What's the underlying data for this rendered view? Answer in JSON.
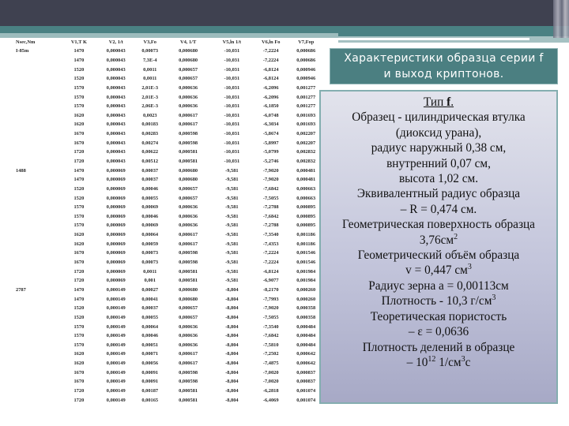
{
  "title_box": {
    "line1": "Характеристики образца серии f",
    "line2": "и выход криптонов."
  },
  "info_box": {
    "heading_prefix": "Тип ",
    "heading_bold": "f",
    "heading_suffix": ".",
    "lines": [
      "Образец - цилиндрическая втулка",
      "(диоксид урана),",
      "радиус наружный 0,38 см,",
      "внутренний 0,07 см,",
      "высота 1,02 см.",
      "Эквивалентный радиус образца",
      "– R = 0,474 см.",
      "Геометрическая поверхность образца"
    ],
    "surface_value": "3,76см",
    "surface_sup": "2",
    "volume_label": "Геометрический объём образца",
    "volume_value": "v = 0,447 см",
    "volume_sup": "3",
    "grain_radius": "Радиус зерна а = 0,00113см",
    "density_value": "Плотность - 10,3 г/см",
    "density_sup": "3",
    "porosity_label": "Теоретическая пористость",
    "porosity_value": "– ε = 0,0636",
    "fission_label": "Плотность делений в образце",
    "fission_prefix": "– 10",
    "fission_exp": "12",
    "fission_unit_a": " 1/см",
    "fission_unit_sup": "3",
    "fission_unit_b": "с"
  },
  "table": {
    "headers": [
      "Nsec,Nm",
      "V1,T K",
      "V2, 1/t",
      "V3,Fo",
      "V4, 1/T",
      "V5,ln 1/t",
      "V6,ln Fo",
      "V7,Fop"
    ],
    "rows": [
      [
        "I-85m",
        "1470",
        "0,000043",
        "0,00073",
        "0,000680",
        "-10,031",
        "-7,2224",
        "0,000686"
      ],
      [
        "",
        "1470",
        "0,000043",
        "7,3E-4",
        "0,000680",
        "-10,031",
        "-7,2224",
        "0,000686"
      ],
      [
        "",
        "1520",
        "0,000043",
        "0,0011",
        "0,000657",
        "-10,031",
        "-6,8124",
        "0,000946"
      ],
      [
        "",
        "1520",
        "0,000043",
        "0,0011",
        "0,000657",
        "-10,031",
        "-6,8124",
        "0,000946"
      ],
      [
        "",
        "1570",
        "0,000043",
        "2,01E-3",
        "0,000636",
        "-10,031",
        "-6,2096",
        "0,001277"
      ],
      [
        "",
        "1570",
        "0,000043",
        "2,01E-3",
        "0,000636",
        "-10,031",
        "-6,2096",
        "0,001277"
      ],
      [
        "",
        "1570",
        "0,000043",
        "2,06E-3",
        "0,000636",
        "-10,031",
        "-6,1850",
        "0,001277"
      ],
      [
        "",
        "1620",
        "0,000043",
        "0,0023",
        "0,000617",
        "-10,031",
        "-6,0748",
        "0,001693"
      ],
      [
        "",
        "1620",
        "0,000043",
        "0,00183",
        "0,000617",
        "-10,031",
        "-6,3034",
        "0,001693"
      ],
      [
        "",
        "1670",
        "0,000043",
        "0,00283",
        "0,000598",
        "-10,031",
        "-5,8674",
        "0,002207"
      ],
      [
        "",
        "1670",
        "0,000043",
        "0,00274",
        "0,000598",
        "-10,031",
        "-5,8997",
        "0,002207"
      ],
      [
        "",
        "1720",
        "0,000043",
        "0,00622",
        "0,000581",
        "-10,031",
        "-5,0799",
        "0,002832"
      ],
      [
        "",
        "1720",
        "0,000043",
        "0,00512",
        "0,000581",
        "-10,031",
        "-5,2746",
        "0,002832"
      ],
      [
        "1488",
        "1470",
        "0,000069",
        "0,00037",
        "0,000680",
        "-9,581",
        "-7,9020",
        "0,000481"
      ],
      [
        "",
        "1470",
        "0,000069",
        "0,00037",
        "0,000680",
        "-9,581",
        "-7,9020",
        "0,000481"
      ],
      [
        "",
        "1520",
        "0,000069",
        "0,00046",
        "0,000657",
        "-9,581",
        "-7,6842",
        "0,000663"
      ],
      [
        "",
        "1520",
        "0,000069",
        "0,00055",
        "0,000657",
        "-9,581",
        "-7,5055",
        "0,000663"
      ],
      [
        "",
        "1570",
        "0,000069",
        "0,00069",
        "0,000636",
        "-9,581",
        "-7,2788",
        "0,000895"
      ],
      [
        "",
        "1570",
        "0,000069",
        "0,00046",
        "0,000636",
        "-9,581",
        "-7,6842",
        "0,000895"
      ],
      [
        "",
        "1570",
        "0,000069",
        "0,00069",
        "0,000636",
        "-9,581",
        "-7,2788",
        "0,000895"
      ],
      [
        "",
        "1620",
        "0,000069",
        "0,00064",
        "0,000617",
        "-9,581",
        "-7,3540",
        "0,001186"
      ],
      [
        "",
        "1620",
        "0,000069",
        "0,00059",
        "0,000617",
        "-9,581",
        "-7,4353",
        "0,001186"
      ],
      [
        "",
        "1670",
        "0,000069",
        "0,00073",
        "0,000598",
        "-9,581",
        "-7,2224",
        "0,001546"
      ],
      [
        "",
        "1670",
        "0,000069",
        "0,00073",
        "0,000598",
        "-9,581",
        "-7,2224",
        "0,001546"
      ],
      [
        "",
        "1720",
        "0,000069",
        "0,0011",
        "0,000581",
        "-9,581",
        "-6,8124",
        "0,001984"
      ],
      [
        "",
        "1720",
        "0,000069",
        "0,001",
        "0,000581",
        "-9,581",
        "-6,9077",
        "0,001984"
      ],
      [
        "2787",
        "1470",
        "0,000149",
        "0,00027",
        "0,000680",
        "-8,804",
        "-8,2170",
        "0,000260"
      ],
      [
        "",
        "1470",
        "0,000149",
        "0,00041",
        "0,000680",
        "-8,804",
        "-7,7993",
        "0,000260"
      ],
      [
        "",
        "1520",
        "0,000149",
        "0,00037",
        "0,000657",
        "-8,804",
        "-7,9020",
        "0,000358"
      ],
      [
        "",
        "1520",
        "0,000149",
        "0,00055",
        "0,000657",
        "-8,804",
        "-7,5055",
        "0,000358"
      ],
      [
        "",
        "1570",
        "0,000149",
        "0,00064",
        "0,000636",
        "-8,804",
        "-7,3540",
        "0,000484"
      ],
      [
        "",
        "1570",
        "0,000149",
        "0,00046",
        "0,000636",
        "-8,804",
        "-7,6842",
        "0,000484"
      ],
      [
        "",
        "1570",
        "0,000149",
        "0,00051",
        "0,000636",
        "-8,804",
        "-7,5810",
        "0,000484"
      ],
      [
        "",
        "1620",
        "0,000149",
        "0,00071",
        "0,000617",
        "-8,804",
        "-7,2502",
        "0,000642"
      ],
      [
        "",
        "1620",
        "0,000149",
        "0,00056",
        "0,000617",
        "-8,804",
        "-7,4875",
        "0,000642"
      ],
      [
        "",
        "1670",
        "0,000149",
        "0,00091",
        "0,000598",
        "-8,804",
        "-7,0020",
        "0,000837"
      ],
      [
        "",
        "1670",
        "0,000149",
        "0,00091",
        "0,000598",
        "-8,804",
        "-7,0020",
        "0,000837"
      ],
      [
        "",
        "1720",
        "0,000149",
        "0,00187",
        "0,000581",
        "-8,804",
        "-6,2818",
        "0,001074"
      ],
      [
        "",
        "1720",
        "0,000149",
        "0,00165",
        "0,000581",
        "-8,804",
        "-6,4069",
        "0,001074"
      ]
    ]
  }
}
